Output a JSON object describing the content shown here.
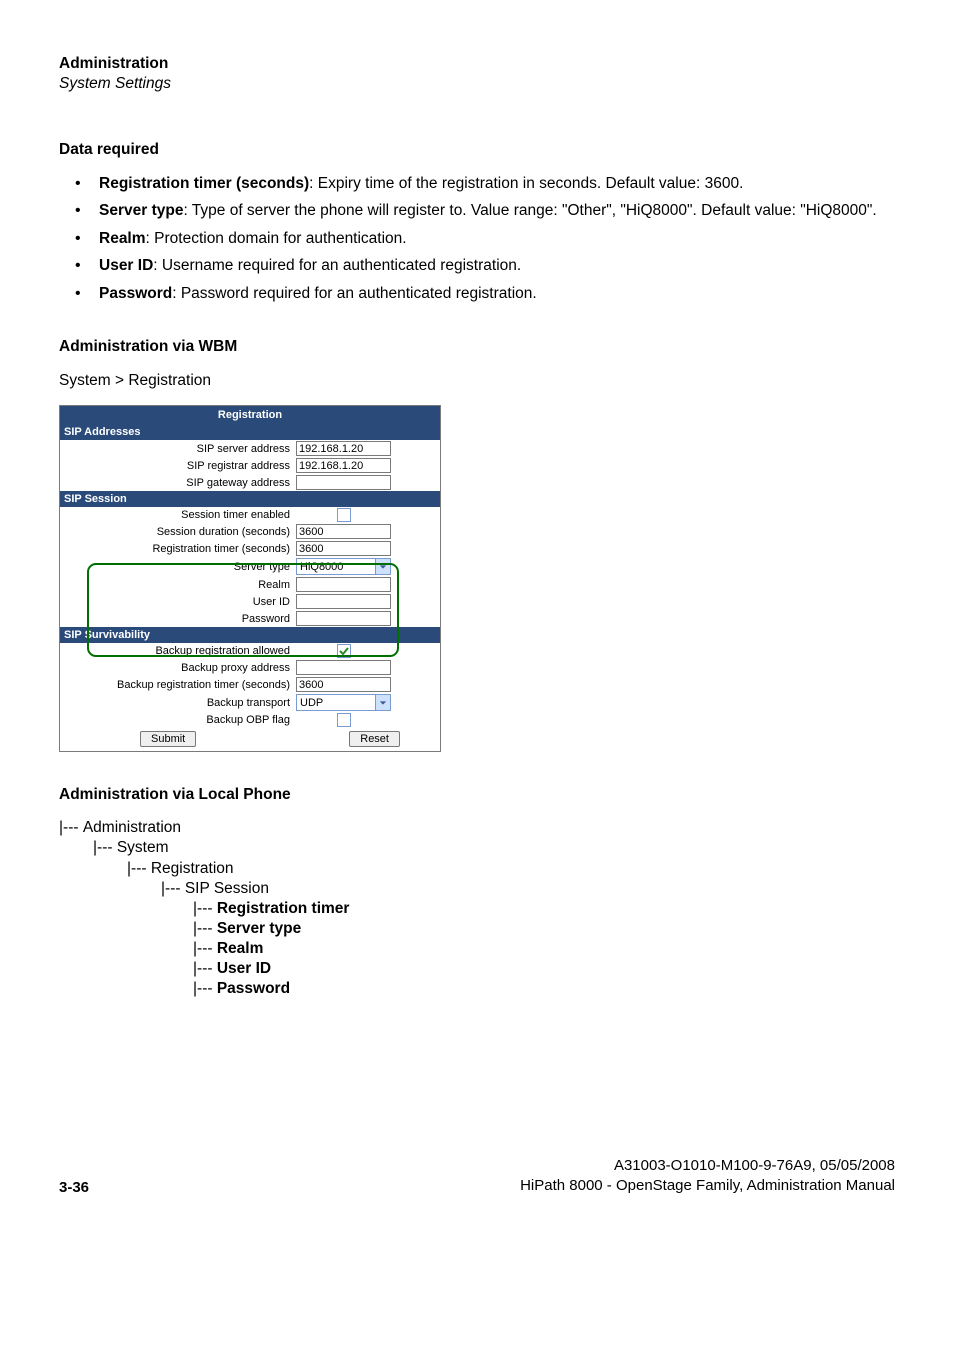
{
  "header": {
    "title": "Administration",
    "subtitle": "System Settings"
  },
  "dataRequired": {
    "heading": "Data required",
    "items": [
      {
        "label": "Registration timer (seconds)",
        "text": ": Expiry time of the registration in seconds. Default value: 3600."
      },
      {
        "label": "Server type",
        "text": ": Type of server the phone will register to. Value range: \"Other\", \"HiQ8000\". Default value: \"HiQ8000\"."
      },
      {
        "label": "Realm",
        "text": ": Protection domain for authentication."
      },
      {
        "label": "User ID",
        "text": ": Username required for an authenticated registration."
      },
      {
        "label": "Password",
        "text": ": Password required for an authenticated registration."
      }
    ]
  },
  "wbm": {
    "heading": "Administration via WBM",
    "breadcrumb": "System > Registration",
    "panel": {
      "title": "Registration",
      "sections": [
        {
          "name": "SIP Addresses",
          "rows": [
            {
              "label": "SIP server address",
              "type": "input",
              "value": "192.168.1.20"
            },
            {
              "label": "SIP registrar address",
              "type": "input",
              "value": "192.168.1.20"
            },
            {
              "label": "SIP gateway address",
              "type": "input",
              "value": ""
            }
          ]
        },
        {
          "name": "SIP Session",
          "rows": [
            {
              "label": "Session timer enabled",
              "type": "checkbox",
              "checked": false
            },
            {
              "label": "Session duration (seconds)",
              "type": "input",
              "value": "3600"
            },
            {
              "label": "Registration timer (seconds)",
              "type": "input",
              "value": "3600"
            },
            {
              "label": "Server type",
              "type": "select",
              "value": "HiQ8000"
            },
            {
              "label": "Realm",
              "type": "input",
              "value": ""
            },
            {
              "label": "User ID",
              "type": "input",
              "value": ""
            },
            {
              "label": "Password",
              "type": "input",
              "value": ""
            }
          ]
        },
        {
          "name": "SIP Survivability",
          "rows": [
            {
              "label": "Backup registration allowed",
              "type": "checkbox",
              "checked": true
            },
            {
              "label": "Backup proxy address",
              "type": "input",
              "value": ""
            },
            {
              "label": "Backup registration timer (seconds)",
              "type": "input",
              "value": "3600"
            },
            {
              "label": "Backup transport",
              "type": "select",
              "value": "UDP"
            },
            {
              "label": "Backup OBP flag",
              "type": "checkbox",
              "checked": false
            }
          ]
        }
      ],
      "buttons": {
        "submit": "Submit",
        "reset": "Reset"
      }
    }
  },
  "localPhone": {
    "heading": "Administration via Local Phone",
    "tree": {
      "l0": "Administration",
      "l1": "System",
      "l2": "Registration",
      "l3": "SIP Session",
      "l4": [
        "Registration timer",
        "Server type",
        "Realm",
        "User ID",
        "Password"
      ]
    }
  },
  "footer": {
    "pageNum": "3-36",
    "line1": "A31003-O1010-M100-9-76A9, 05/05/2008",
    "line2": "HiPath 8000 - OpenStage Family, Administration Manual"
  }
}
